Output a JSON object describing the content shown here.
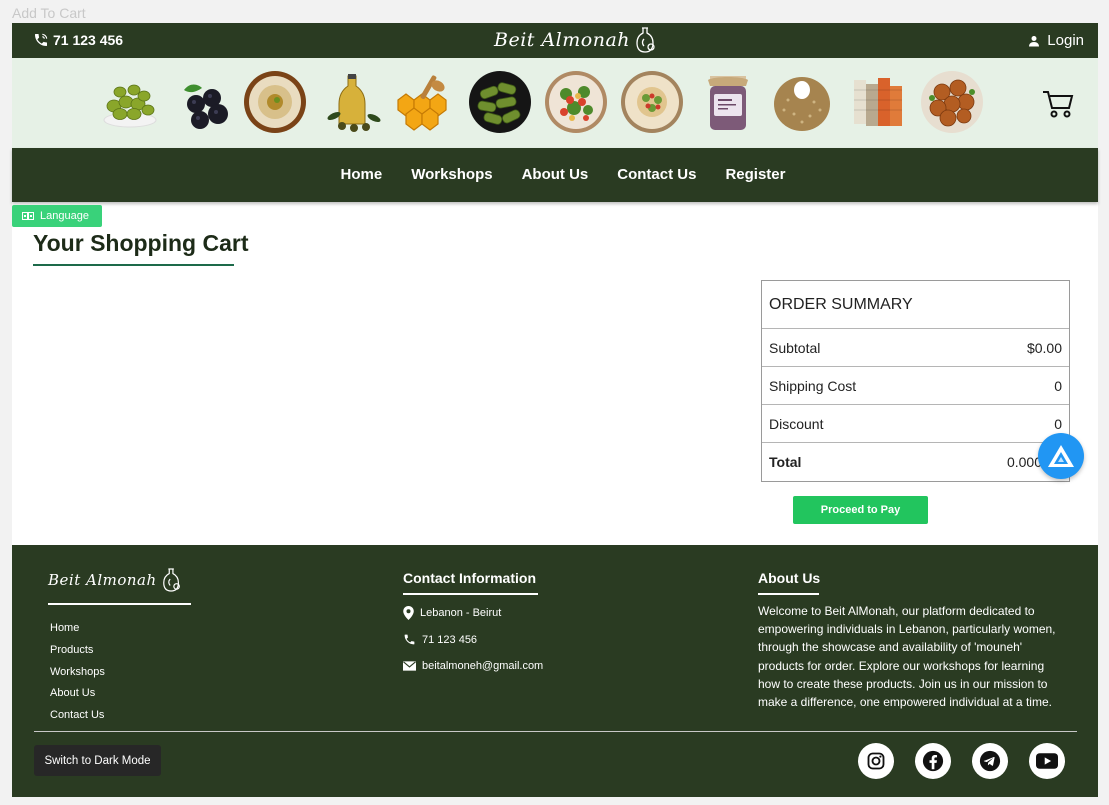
{
  "page_label": "Add To Cart",
  "topbar": {
    "phone": "71 123 456",
    "brand": "Beit Almonah",
    "login_label": "Login"
  },
  "product_strip": {
    "items": [
      "olives-icon",
      "blackberries-icon",
      "hummus-icon",
      "olive-oil-icon",
      "honeycomb-icon",
      "stuffed-grape-leaves-icon",
      "salad-icon",
      "tabbouleh-plate-icon",
      "jam-jar-icon",
      "kaak-bread-icon",
      "thread-spools-icon",
      "falafel-icon"
    ]
  },
  "nav": {
    "items": [
      "Home",
      "Workshops",
      "About Us",
      "Contact Us",
      "Register"
    ]
  },
  "language_label": "Language",
  "cart": {
    "title": "Your Shopping Cart"
  },
  "summary": {
    "heading": "ORDER SUMMARY",
    "rows": [
      {
        "label": "Subtotal",
        "value": "$0.00"
      },
      {
        "label": "Shipping Cost",
        "value": "0"
      },
      {
        "label": "Discount",
        "value": "0"
      },
      {
        "label": "Total",
        "value": "0.000"
      }
    ],
    "pay_label": "Proceed to Pay"
  },
  "footer": {
    "brand": "Beit Almonah",
    "links": [
      "Home",
      "Products",
      "Workshops",
      "About Us",
      "Contact Us"
    ],
    "contact_title": "Contact Information",
    "contact": {
      "location": "Lebanon - Beirut",
      "phone": "71 123 456",
      "email": "beitalmoneh@gmail.com"
    },
    "about_title": "About Us",
    "about_text": "Welcome to Beit AlMonah, our platform dedicated to empowering individuals in Lebanon, particularly women, through the showcase and availability of 'mouneh' products for order. Explore our workshops for learning how to create these products. Join us in our mission to make a difference, one empowered individual at a time.",
    "dark_mode_label": "Switch to Dark Mode",
    "social": [
      "instagram-icon",
      "facebook-icon",
      "telegram-icon",
      "youtube-icon"
    ]
  },
  "colors": {
    "header_green": "#2a3b22",
    "strip_bg": "#e6f1e6",
    "accent_green": "#22c55e",
    "fab_blue": "#2196f3"
  }
}
